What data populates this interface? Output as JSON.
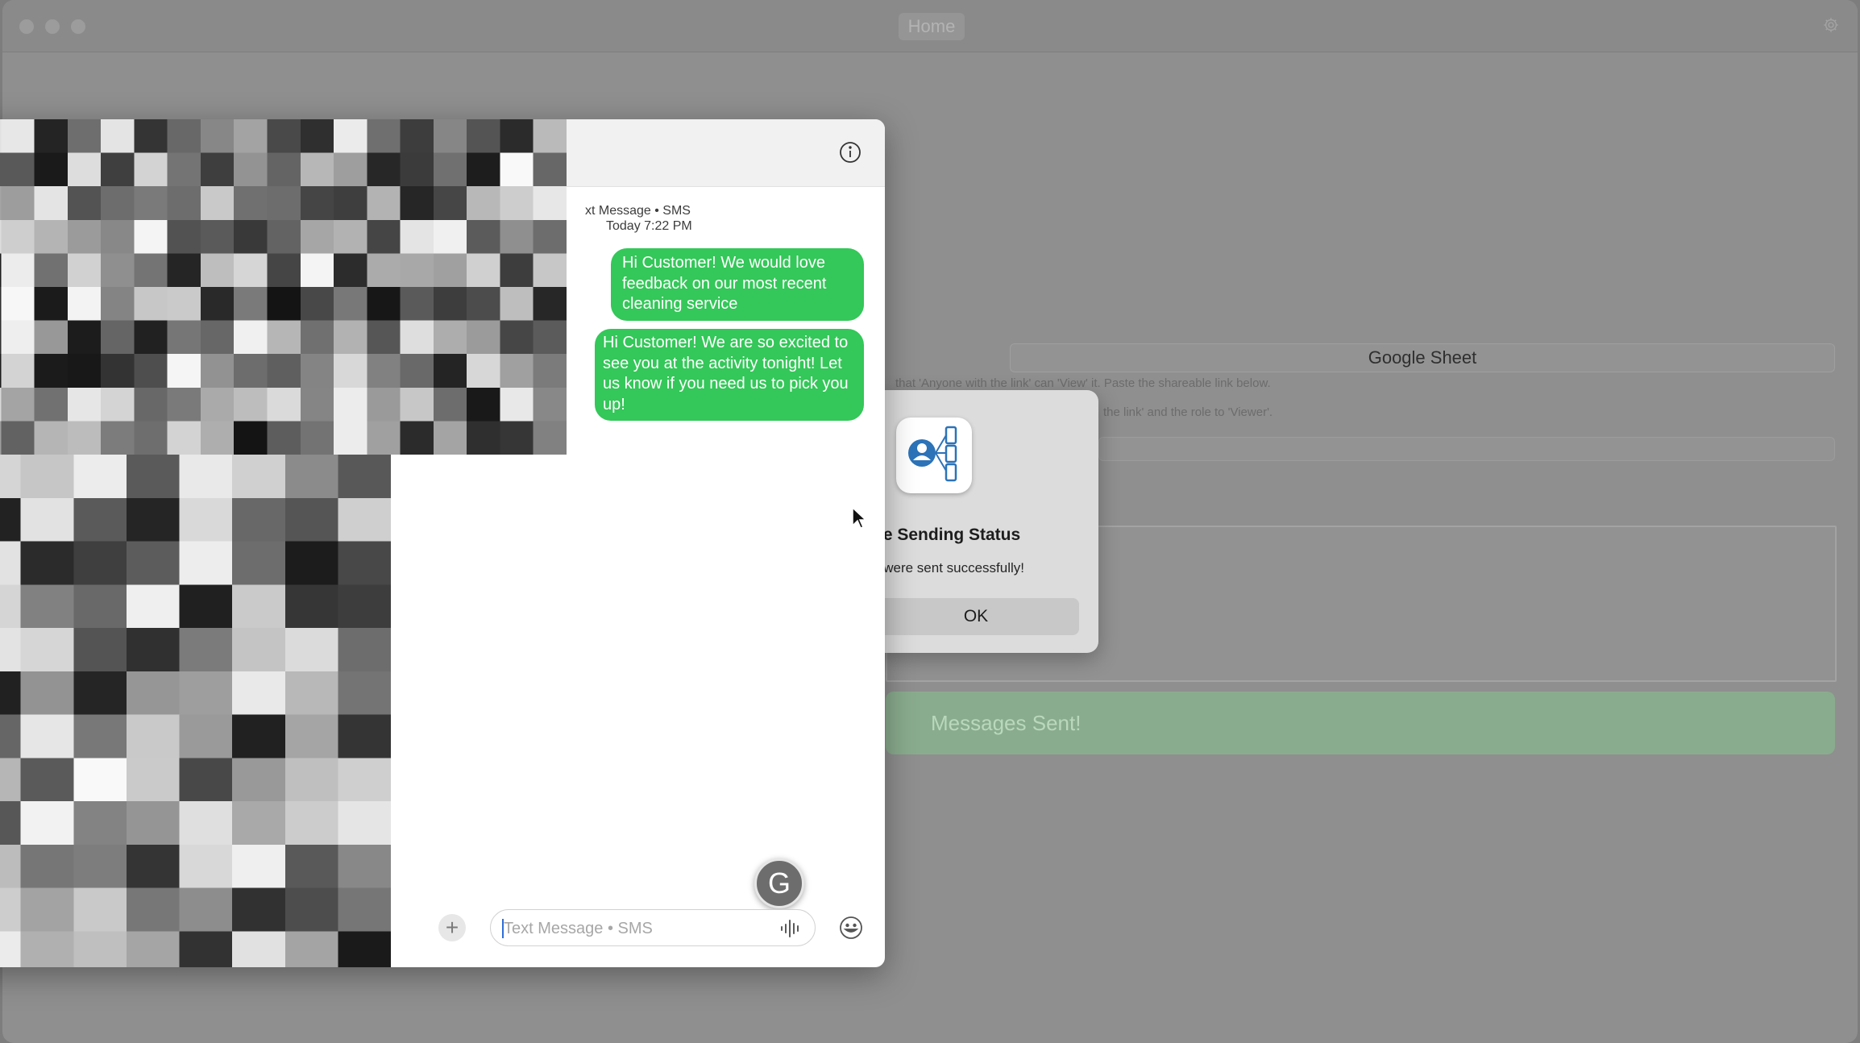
{
  "window": {
    "tab_title": "Home"
  },
  "form": {
    "sheet_button_label": "Google Sheet",
    "hint_1": "that 'Anyone with the link' can 'View' it. Paste the shareable link below.",
    "hint_2": "the link' and the role to 'Viewer'.",
    "link_value": "",
    "status_banner": "Messages Sent!"
  },
  "alert": {
    "title": "ge Sending Status",
    "message": "s were sent successfully!",
    "ok_label": "OK",
    "icon": "contact-network-icon"
  },
  "messages": {
    "service_line": "xt Message • SMS",
    "timestamp": "Today 7:22 PM",
    "bubbles": [
      "Hi Customer! We would love feedback on our most recent cleaning service",
      "Hi Customer! We are so excited to see you at the activity tonight! Let us know if you need us to pick you up!"
    ],
    "bubble_color": "#34c759",
    "compose_placeholder": "Text Message • SMS",
    "compose_value": "",
    "grammarly_letter": "G"
  }
}
